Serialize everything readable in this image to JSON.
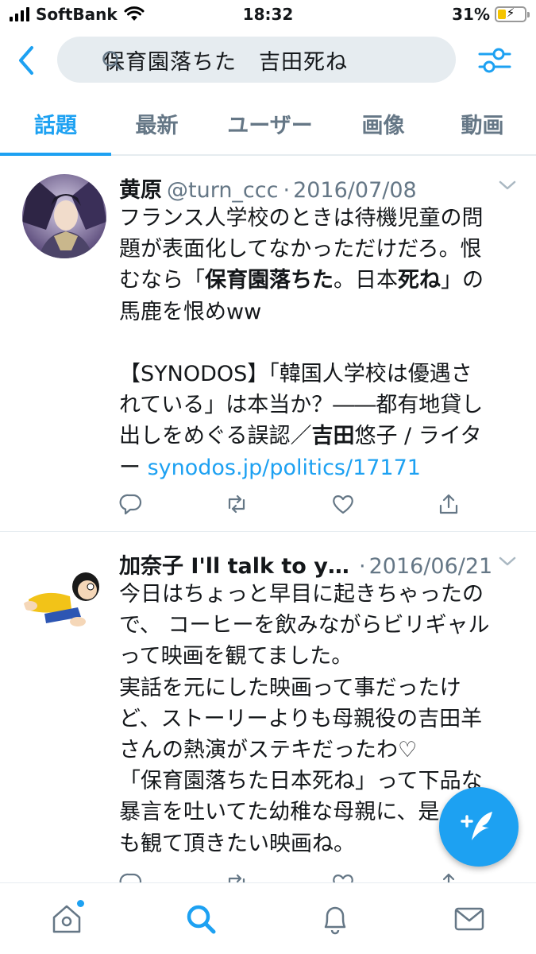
{
  "status_bar": {
    "carrier": "SoftBank",
    "time": "18:32",
    "battery_percent": "31%",
    "battery_level": 0.31,
    "charging": true,
    "icons": [
      "signal-icon",
      "wifi-icon",
      "battery-icon"
    ]
  },
  "search": {
    "query": "保育園落ちた　吉田死ね",
    "icons": [
      "back-icon",
      "search-icon",
      "filter-icon"
    ]
  },
  "tabs": [
    {
      "label": "話題",
      "active": true
    },
    {
      "label": "最新",
      "active": false
    },
    {
      "label": "ユーザー",
      "active": false
    },
    {
      "label": "画像",
      "active": false
    },
    {
      "label": "動画",
      "active": false
    }
  ],
  "tweets": [
    {
      "name": "黄原",
      "handle": "@turn_ccc",
      "date": "2016/07/08",
      "lines": [
        "フランス人学校のときは待機児童の問",
        "題が表面化してなかっただけだろ。恨",
        "むなら「保育園落ちた。日本死ね」の",
        "馬鹿を恨めww",
        "",
        "【SYNODOS】「韓国人学校は優遇さ",
        "れている」は本当か？――都有地貸し",
        "出しをめぐる誤認／吉田悠子 / ライタ",
        "ー "
      ],
      "bold_1": "保育園落ちた",
      "bold_2": "死ね",
      "bold_3": "吉田",
      "link": "synodos.jp/politics/17171"
    },
    {
      "name": "加奈子 I'll talk to yo...",
      "date": "2016/06/21",
      "lines": [
        "今日はちょっと早目に起きちゃったの",
        "で、 コーヒーを飲みながらビリギャル",
        "って映画を観てました。",
        "実話を元にした映画って事だったけ",
        "ど、ストーリーよりも母親役の吉田羊",
        "さんの熱演がステキだったわ♡",
        "「保育園落ちた日本死ね」って下品な",
        "暴言を吐いてた幼稚な母親に、是",
        "も観て頂きたい映画ね。"
      ]
    }
  ],
  "bottom_nav": [
    "home-icon",
    "search-icon",
    "notifications-icon",
    "messages-icon"
  ],
  "colors": {
    "accent": "#1da1f2",
    "secondary_text": "#657786",
    "divider": "#e6ecf0"
  }
}
